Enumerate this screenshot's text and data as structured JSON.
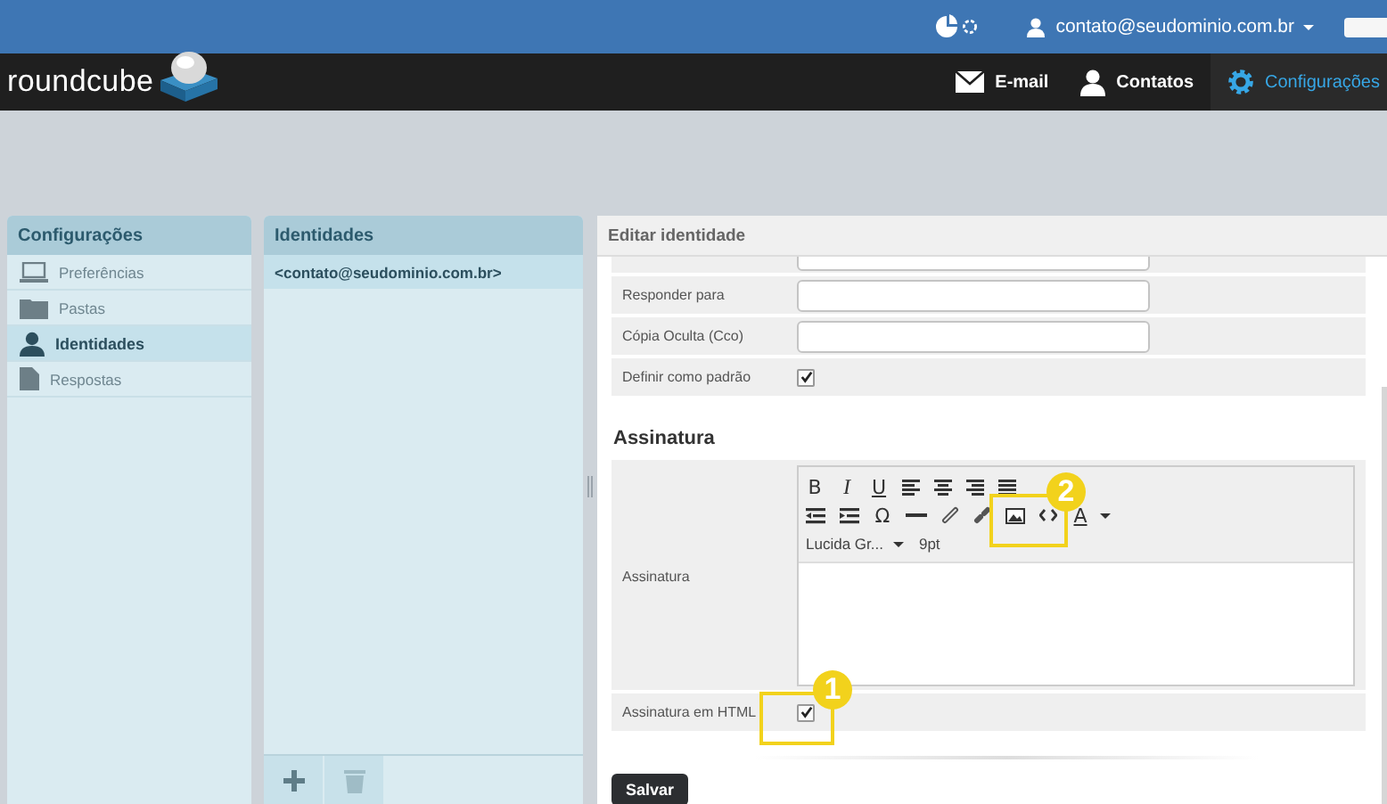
{
  "topbar": {
    "user_email": "contato@seudominio.com.br"
  },
  "logo": "roundcube",
  "nav": [
    {
      "kind": "mail",
      "label": "E-mail",
      "selected": false
    },
    {
      "kind": "contacts",
      "label": "Contatos",
      "selected": false
    },
    {
      "kind": "settings",
      "label": "Configurações",
      "selected": true
    }
  ],
  "settings_panel": {
    "title": "Configurações",
    "items": [
      {
        "kind": "laptop",
        "label": "Preferências",
        "selected": false
      },
      {
        "kind": "folder",
        "label": "Pastas",
        "selected": false
      },
      {
        "kind": "person",
        "label": "Identidades",
        "selected": true
      },
      {
        "kind": "document",
        "label": "Respostas",
        "selected": false
      }
    ]
  },
  "identities_panel": {
    "title": "Identidades",
    "items": [
      {
        "label": "<contato@seudominio.com.br>",
        "selected": true
      }
    ]
  },
  "edit_panel": {
    "title": "Editar identidade",
    "fields": [
      {
        "kind": "input"
      },
      {
        "kind": "input",
        "label": "Responder para"
      },
      {
        "kind": "input",
        "label": "Cópia Oculta (Cco)"
      },
      {
        "kind": "checkbox",
        "label": "Definir como padrão",
        "checked": true
      }
    ],
    "section_title": "Assinatura",
    "signature": {
      "label": "Assinatura",
      "toolbar": [
        [
          {
            "kind": "glyph",
            "text": "B"
          },
          {
            "kind": "glyph-italic",
            "text": "I"
          },
          {
            "kind": "glyph-underline",
            "text": "U"
          },
          {
            "kind": "align-left"
          },
          {
            "kind": "align-center"
          },
          {
            "kind": "align-right"
          },
          {
            "kind": "align-justify"
          }
        ],
        [
          {
            "kind": "outdent"
          },
          {
            "kind": "indent"
          },
          {
            "kind": "glyph",
            "text": "Ω"
          },
          {
            "kind": "hr"
          },
          {
            "kind": "link"
          },
          {
            "kind": "unlink"
          },
          {
            "kind": "image",
            "callout": "2"
          },
          {
            "kind": "source"
          },
          {
            "kind": "glyph-underline",
            "text": "A"
          },
          {
            "kind": "caret"
          }
        ],
        [
          {
            "kind": "label",
            "text": "Lucida Gr..."
          },
          {
            "kind": "caret"
          },
          {
            "kind": "label",
            "text": "9pt"
          }
        ]
      ]
    },
    "html_signature": {
      "label": "Assinatura em HTML",
      "checked": true,
      "callout": "1"
    },
    "save_button": "Salvar"
  }
}
